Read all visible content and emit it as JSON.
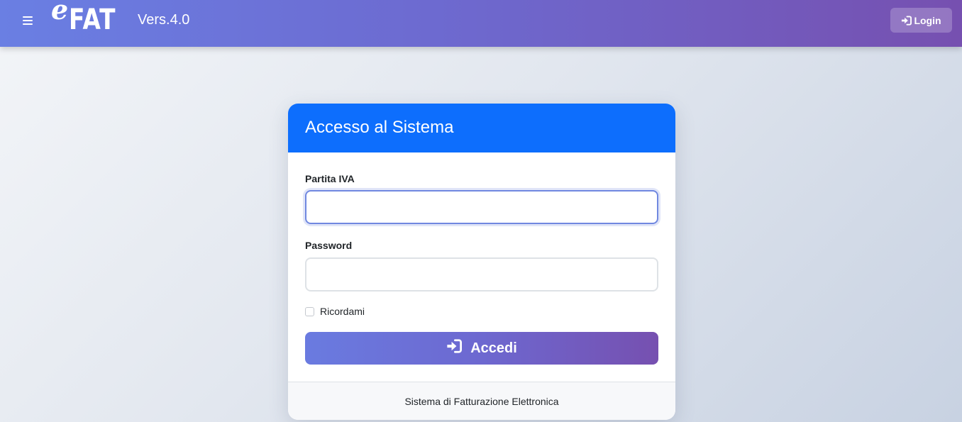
{
  "navbar": {
    "menu_icon": "hamburger-icon",
    "logo": {
      "prefix": "e",
      "main": "FAT"
    },
    "version": "Vers.4.0",
    "login_button": {
      "label": "Login",
      "icon": "sign-in-icon"
    }
  },
  "login_card": {
    "title": "Accesso al Sistema",
    "fields": {
      "partita_iva": {
        "label": "Partita IVA",
        "value": "",
        "placeholder": ""
      },
      "password": {
        "label": "Password",
        "value": "",
        "placeholder": ""
      }
    },
    "remember_me": {
      "label": "Ricordami",
      "checked": false
    },
    "submit_button": {
      "label": "Accedi",
      "icon": "sign-in-icon"
    },
    "footer_text": "Sistema di Fatturazione Elettronica"
  },
  "colors": {
    "header_gradient_start": "#6a7fe3",
    "header_gradient_end": "#7650b0",
    "card_header": "#0d6efd",
    "focus_border": "#7088e0"
  }
}
